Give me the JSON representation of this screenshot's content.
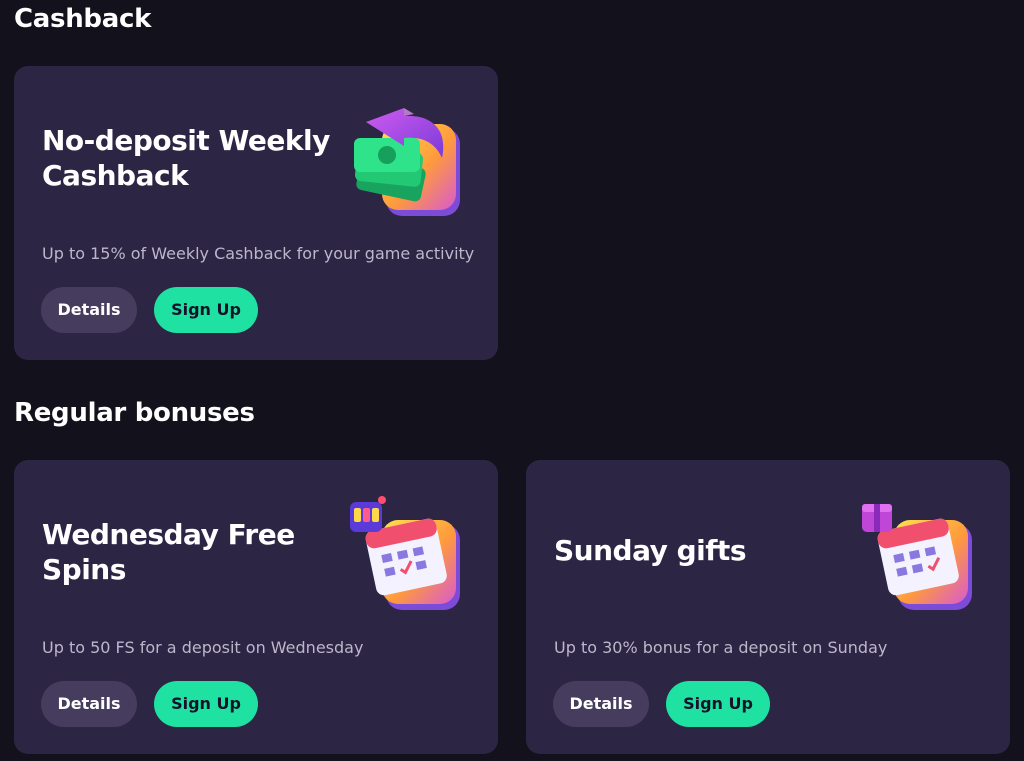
{
  "sections": {
    "cashback": {
      "title": "Cashback"
    },
    "regular": {
      "title": "Regular bonuses"
    }
  },
  "cards": [
    {
      "title": "No-deposit Weekly Cashback",
      "description": "Up to 15% of Weekly Cashback for your game activity",
      "details_label": "Details",
      "signup_label": "Sign Up",
      "icon": "cashback-money-arrow-icon"
    },
    {
      "title": "Wednesday Free Spins",
      "description": "Up to 50 FS for a deposit on Wednesday",
      "details_label": "Details",
      "signup_label": "Sign Up",
      "icon": "calendar-slot-machine-icon"
    },
    {
      "title": "Sunday gifts",
      "description": "Up to 30% bonus for a deposit on Sunday",
      "details_label": "Details",
      "signup_label": "Sign Up",
      "icon": "calendar-gift-icon"
    }
  ],
  "colors": {
    "background": "#13111c",
    "card": "#2d2544",
    "details_button": "#463d5e",
    "signup_button": "#1fe1a1",
    "description_text": "#bdb7cc"
  }
}
